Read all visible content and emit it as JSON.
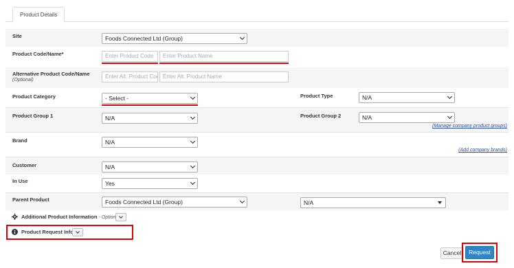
{
  "tabs": [
    {
      "label": "Product Details"
    }
  ],
  "fields": {
    "site": {
      "label": "Site",
      "value": "Foods Connected Ltd (Group)"
    },
    "product_code_name": {
      "label": "Product Code/Name*",
      "code_placeholder": "Enter Product Code",
      "name_placeholder": "Enter Product Name"
    },
    "alt_code_name": {
      "label": "Alternative Product Code/Name",
      "sublabel": "(Optional)",
      "code_placeholder": "Enter Alt. Product Code",
      "name_placeholder": "Enter Alt. Product Name"
    },
    "product_category": {
      "label": "Product Category",
      "value": "- Select -"
    },
    "product_type": {
      "label": "Product Type",
      "value": "N/A"
    },
    "product_group_1": {
      "label": "Product Group 1",
      "value": "N/A"
    },
    "product_group_2": {
      "label": "Product Group 2",
      "value": "N/A",
      "link": "(Manage company product groups)"
    },
    "brand": {
      "label": "Brand",
      "value": "N/A",
      "link": "(Add company brands)"
    },
    "customer": {
      "label": "Customer",
      "value": "N/A"
    },
    "in_use": {
      "label": "In Use",
      "value": "Yes"
    },
    "parent_product": {
      "label": "Parent Product",
      "value": "Foods Connected Ltd (Group)",
      "secondary_value": "N/A"
    }
  },
  "sections": {
    "additional_info": {
      "label": "Additional Product Information",
      "suffix": "- Optional"
    },
    "request_info": {
      "label": "Product Request Info"
    }
  },
  "buttons": {
    "cancel": "Cancel",
    "request": "Request"
  },
  "colors": {
    "highlight": "#e00000",
    "primary": "#2e86c9",
    "link": "#2a4fb0"
  }
}
